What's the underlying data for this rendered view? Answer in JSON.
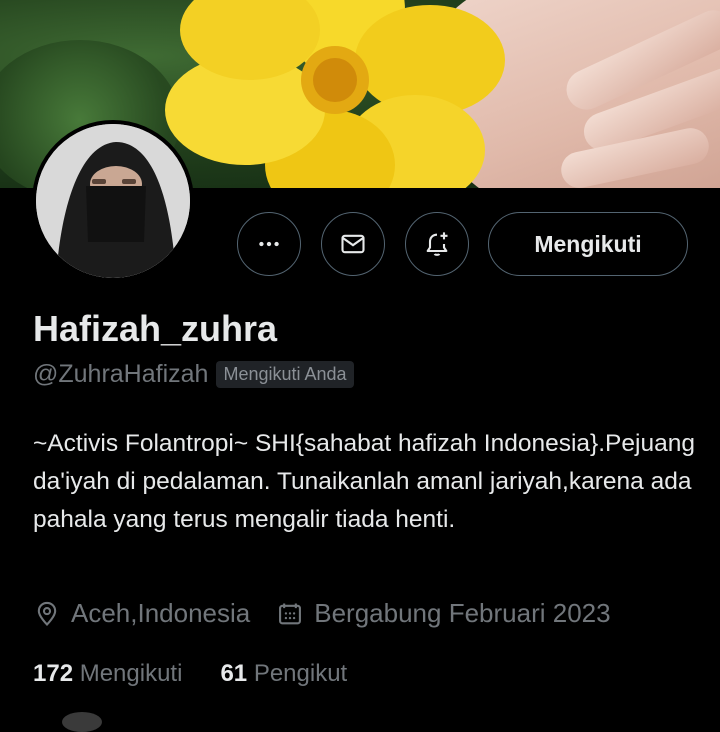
{
  "profile": {
    "name": "Hafizah_zuhra",
    "handle": "@ZuhraHafizah",
    "follows_you_badge": "Mengikuti Anda",
    "bio": "~Activis Folantropi~ SHI{sahabat hafizah Indonesia}.Pejuang da'iyah di pedalaman. Tunaikanlah amanl jariyah,karena ada pahala yang terus mengalir tiada henti.",
    "location": "Aceh,Indonesia",
    "joined": "Bergabung Februari 2023"
  },
  "actions": {
    "follow_label": "Mengikuti",
    "more_icon": "more-horizontal-icon",
    "message_icon": "envelope-icon",
    "notify_icon": "bell-plus-icon"
  },
  "stats": {
    "following_count": "172",
    "following_label": "Mengikuti",
    "followers_count": "61",
    "followers_label": "Pengikut"
  },
  "colors": {
    "background": "#000000",
    "text_primary": "#e7e9ea",
    "text_secondary": "#71767b",
    "border": "#536471",
    "badge_bg": "#202327"
  }
}
